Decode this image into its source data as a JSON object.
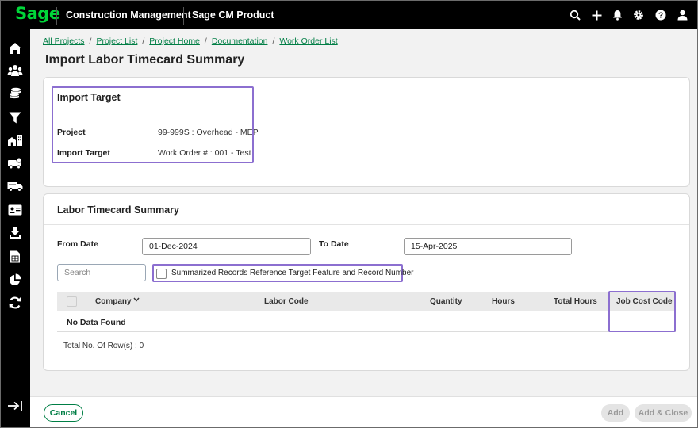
{
  "topbar": {
    "logo": "Sage",
    "app_title": "Construction Management",
    "product": "Sage CM Product",
    "icons": [
      "search-icon",
      "add-icon",
      "bell-icon",
      "gear-icon",
      "help-icon",
      "user-icon"
    ]
  },
  "sidebar": {
    "icons": [
      "home-icon",
      "people-icon",
      "coins-icon",
      "filter-icon",
      "buildings-icon",
      "truck-settings-icon",
      "delivery-truck-icon",
      "id-card-icon",
      "download-icon",
      "spreadsheet-icon",
      "pie-chart-icon",
      "sync-icon",
      "expand-icon"
    ]
  },
  "breadcrumb": [
    "All Projects",
    "Project List",
    "Project Home",
    "Documentation",
    "Work Order List"
  ],
  "page_title": "Import Labor Timecard Summary",
  "import_target": {
    "title": "Import Target",
    "project_label": "Project",
    "project_value": "99-999S : Overhead - MEP",
    "target_label": "Import Target",
    "target_value": "Work Order # : 001 - Test"
  },
  "summary": {
    "title": "Labor Timecard Summary",
    "from_label": "From Date",
    "from_value": "01-Dec-2024",
    "to_label": "To Date",
    "to_value": "15-Apr-2025",
    "search_placeholder": "Search",
    "checkbox_label": "Summarized Records Reference Target Feature and Record Number",
    "columns": [
      "Company",
      "Labor Code",
      "Quantity",
      "Hours",
      "Total Hours",
      "Job Cost Code"
    ],
    "no_data": "No Data Found",
    "total_rows": "Total No. Of Row(s) : 0"
  },
  "footer": {
    "cancel": "Cancel",
    "add": "Add",
    "add_close": "Add & Close"
  },
  "colors": {
    "brand_green": "#00d639",
    "link_green": "#007e45",
    "highlight": "#8c6fd0"
  }
}
